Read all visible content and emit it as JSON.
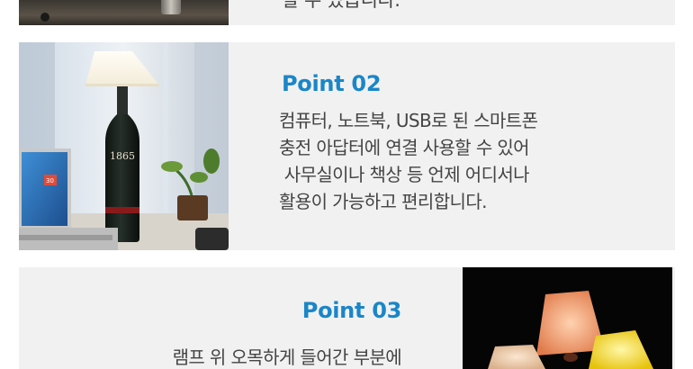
{
  "section1": {
    "description": "할 수 있습니다."
  },
  "section2": {
    "title": "Point 02",
    "lines": [
      "컴퓨터, 노트북, USB로 된 스마트폰",
      "충전 아답터에 연결 사용할 수 있어",
      " 사무실이나 책상 등 언제 어디서나",
      "활용이 가능하고 편리합니다."
    ],
    "bottle_label": "1865",
    "calendar_day": "30"
  },
  "section3": {
    "title": "Point 03",
    "lines": [
      "램프 위 오목하게 들어간 부분에"
    ]
  },
  "colors": {
    "title_blue": "#1a86c8",
    "panel_gray": "#f1f1f1",
    "body_text": "#444444"
  }
}
